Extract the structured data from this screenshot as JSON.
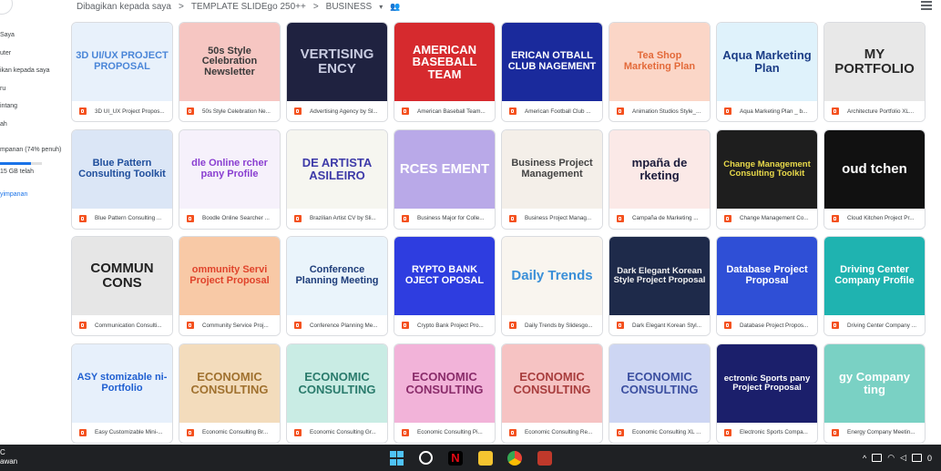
{
  "breadcrumb": {
    "items": [
      "Dibagikan kepada saya",
      "TEMPLATE SLIDEgo 250++",
      "BUSINESS"
    ],
    "separator": ">"
  },
  "sidebar": {
    "items": [
      "Saya",
      "uter",
      "ikan kepada saya",
      "ru",
      "intang",
      "ah"
    ],
    "storage_label": "mpanan (74% penuh)",
    "storage_percent": 74,
    "storage_detail": "15 GB telah",
    "buy_label": "yimpanan"
  },
  "files": [
    {
      "caption": "3D UI_UX Project Propos...",
      "thumb_title": "3D UI/UX PROJECT PROPOSAL",
      "bg": "#e8f1fb",
      "fg": "#4a86d8"
    },
    {
      "caption": "50s Style Celebration Ne...",
      "thumb_title": "50s Style Celebration Newsletter",
      "bg": "#f6c6c2",
      "fg": "#3a3a3a"
    },
    {
      "caption": "Advertising Agency by Sl...",
      "thumb_title": "VERTISING ENCY",
      "bg": "#1f2240",
      "fg": "#c8cbe0"
    },
    {
      "caption": "American Baseball Team...",
      "thumb_title": "AMERICAN BASEBALL TEAM",
      "bg": "#d62a2e",
      "fg": "#ffffff"
    },
    {
      "caption": "American Football Club ...",
      "thumb_title": "ERICAN OTBALL CLUB NAGEMENT",
      "bg": "#1a2a9c",
      "fg": "#ffffff"
    },
    {
      "caption": "Animation Studios Style_...",
      "thumb_title": "Tea Shop Marketing Plan",
      "bg": "#fbd6c7",
      "fg": "#e36a3a"
    },
    {
      "caption": "Aqua Marketing Plan _ b...",
      "thumb_title": "Aqua Marketing Plan",
      "bg": "#dff2fb",
      "fg": "#1b3d86"
    },
    {
      "caption": "Architecture Portfolio XL...",
      "thumb_title": "MY PORTFOLIO",
      "bg": "#e8e8e8",
      "fg": "#2a2a2a"
    },
    {
      "caption": "Blue Pattern Consulting ...",
      "thumb_title": "Blue Pattern Consulting Toolkit",
      "bg": "#dbe6f6",
      "fg": "#1f4e9c"
    },
    {
      "caption": "Boodle Online Searcher ...",
      "thumb_title": "dle Online rcher pany Profile",
      "bg": "#f6f1fb",
      "fg": "#8a3fd1"
    },
    {
      "caption": "Brazilian Artist CV by Sli...",
      "thumb_title": "DE ARTISTA ASILEIRO",
      "bg": "#f6f6f0",
      "fg": "#3d3aa8"
    },
    {
      "caption": "Business Major for Colle...",
      "thumb_title": "RCES EMENT",
      "bg": "#b9a9e8",
      "fg": "#ffffff"
    },
    {
      "caption": "Business Project Manag...",
      "thumb_title": "Business Project Management",
      "bg": "#f4efe9",
      "fg": "#444444"
    },
    {
      "caption": "Campaña de Marketing ...",
      "thumb_title": "mpaña de rketing",
      "bg": "#fbe9e7",
      "fg": "#1a1a3a"
    },
    {
      "caption": "Change Management Co...",
      "thumb_title": "Change Management Consulting Toolkit",
      "bg": "#1e1e1e",
      "fg": "#e8d94a"
    },
    {
      "caption": "Cloud Kitchen Project Pr...",
      "thumb_title": "oud tchen",
      "bg": "#111111",
      "fg": "#ffffff"
    },
    {
      "caption": "Communication Consulti...",
      "thumb_title": "COMMUN CONS",
      "bg": "#e6e6e6",
      "fg": "#222222"
    },
    {
      "caption": "Community Service Proj...",
      "thumb_title": "ommunity Servi Project Proposal",
      "bg": "#f8c9a6",
      "fg": "#e0432b"
    },
    {
      "caption": "Conference Planning Me...",
      "thumb_title": "Conference Planning Meeting",
      "bg": "#eaf4fb",
      "fg": "#1e3d7a"
    },
    {
      "caption": "Crypto Bank Project Pro...",
      "thumb_title": "RYPTO BANK OJECT OPOSAL",
      "bg": "#2e3de0",
      "fg": "#ffffff"
    },
    {
      "caption": "Daily Trends by Slidesgo...",
      "thumb_title": "Daily Trends",
      "bg": "#f9f5ef",
      "fg": "#3a8fd8"
    },
    {
      "caption": "Dark Elegant Korean Styl...",
      "thumb_title": "Dark Elegant Korean Style Project Proposal",
      "bg": "#1e2a4a",
      "fg": "#f1f1f1"
    },
    {
      "caption": "Database Project Propos...",
      "thumb_title": "Database Project Proposal",
      "bg": "#2f4fd6",
      "fg": "#ffffff"
    },
    {
      "caption": "Driving Center Company ...",
      "thumb_title": "Driving Center Company Profile",
      "bg": "#1fb3b0",
      "fg": "#ffffff"
    },
    {
      "caption": "Easy Customizable Mini-...",
      "thumb_title": "ASY stomizable ni-Portfolio",
      "bg": "#e7f0fb",
      "fg": "#1f5fd1"
    },
    {
      "caption": "Economic Consulting Br...",
      "thumb_title": "ECONOMIC CONSULTING",
      "bg": "#f3dcbc",
      "fg": "#a0712f"
    },
    {
      "caption": "Economic Consulting Gr...",
      "thumb_title": "ECONOMIC CONSULTING",
      "bg": "#c9ece4",
      "fg": "#2a7b6c"
    },
    {
      "caption": "Economic Consulting Pi...",
      "thumb_title": "ECONOMIC CONSULTING",
      "bg": "#f2b3d9",
      "fg": "#8a2c6a"
    },
    {
      "caption": "Economic Consulting Re...",
      "thumb_title": "ECONOMIC CONSULTING",
      "bg": "#f6c3c3",
      "fg": "#a83d3d"
    },
    {
      "caption": "Economic Consulting XL ...",
      "thumb_title": "ECONOMIC CONSULTING",
      "bg": "#cdd6f3",
      "fg": "#3b4fa0"
    },
    {
      "caption": "Electronic Sports Compa...",
      "thumb_title": "ectronic Sports pany Project Proposal",
      "bg": "#1b1f6b",
      "fg": "#ffffff"
    },
    {
      "caption": "Energy Company Meetin...",
      "thumb_title": "gy Company ting",
      "bg": "#7ad1c4",
      "fg": "#ffffff"
    }
  ],
  "taskbar": {
    "left_text": [
      "C",
      "awan"
    ],
    "icons": [
      "windows-logo",
      "search",
      "netflix",
      "file-explorer",
      "chrome",
      "app"
    ],
    "right_partial": "0"
  }
}
